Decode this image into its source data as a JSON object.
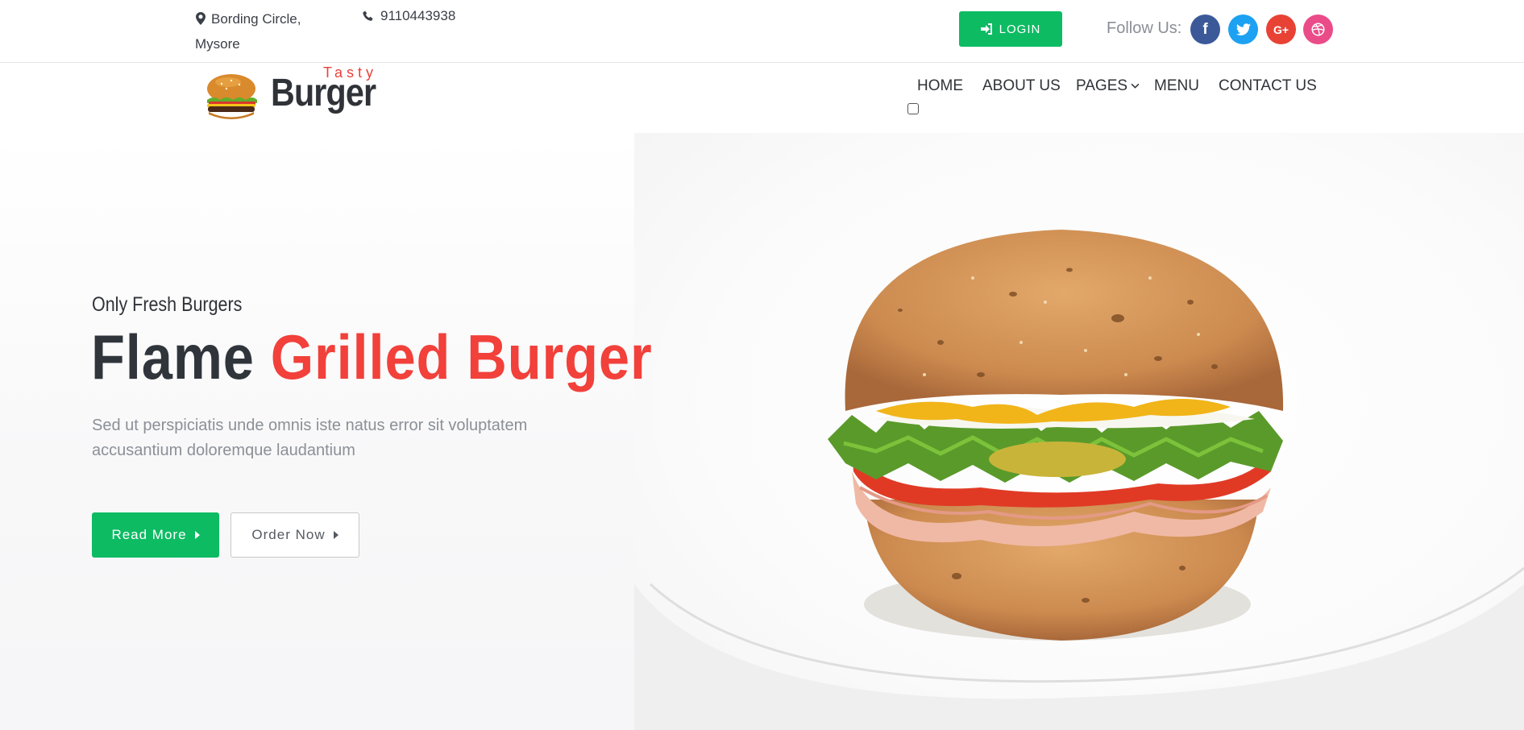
{
  "topbar": {
    "address": "Bording Circle, Mysore",
    "phone": "9110443938",
    "login_label": "LOGIN",
    "follow_label": "Follow Us:",
    "social": [
      {
        "name": "facebook",
        "glyph": "f",
        "color": "#3b5998"
      },
      {
        "name": "twitter",
        "glyph": "t",
        "color": "#1da1f2"
      },
      {
        "name": "google-plus",
        "glyph": "G+",
        "color": "#e84235"
      },
      {
        "name": "dribbble",
        "glyph": "d",
        "color": "#ea4c89"
      }
    ]
  },
  "brand": {
    "tasty": "Tasty",
    "name": "Burger"
  },
  "nav": {
    "items": [
      "HOME",
      "ABOUT US",
      "PAGES",
      "MENU",
      "CONTACT US"
    ]
  },
  "hero": {
    "tagline": "Only Fresh Burgers",
    "headline_dark": "Flame",
    "headline_red": "Grilled Burger",
    "description": "Sed ut perspiciatis unde omnis iste natus error sit voluptatem accusantium doloremque laudantium",
    "read_more": "Read More",
    "order_now": "Order Now"
  },
  "colors": {
    "accent_green": "#0dbb63",
    "accent_red": "#f2403a",
    "text_dark": "#30353c"
  }
}
